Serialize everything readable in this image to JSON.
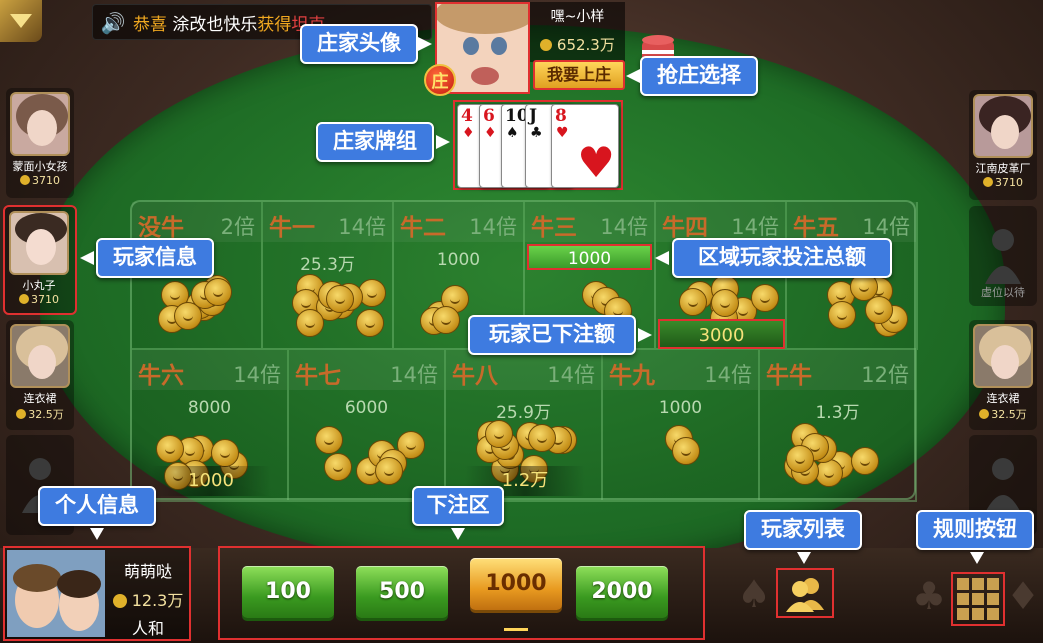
{
  "announcement": {
    "prefix": "恭喜",
    "text": "涂改也快乐",
    "suffix1": "获",
    "suffix2": "得",
    "suffix3": "坦克"
  },
  "banker": {
    "name": "嘿~小样",
    "coins": "652.3万",
    "badge": "庄",
    "grab_button": "我要上庄",
    "cards": [
      {
        "rank": "4",
        "suit": "♦",
        "color": "#d8151e"
      },
      {
        "rank": "6",
        "suit": "♦",
        "color": "#d8151e"
      },
      {
        "rank": "10",
        "suit": "♠",
        "color": "#111111"
      },
      {
        "rank": "J",
        "suit": "♣",
        "color": "#111111"
      },
      {
        "rank": "8",
        "suit": "♥",
        "color": "#d8151e"
      }
    ]
  },
  "left_players": [
    {
      "name": "蒙面小女孩",
      "coins": "3710"
    },
    {
      "name": "小丸子",
      "coins": "3710"
    },
    {
      "name": "连衣裙",
      "coins": "32.5万"
    },
    {
      "name": "",
      "coins": ""
    }
  ],
  "right_players": [
    {
      "name": "江南皮革厂",
      "coins": "3710"
    },
    {
      "name": "虚位以待",
      "coins": ""
    },
    {
      "name": "连衣裙",
      "coins": "32.5万"
    },
    {
      "name": "",
      "coins": ""
    }
  ],
  "zones_row1": [
    {
      "name": "没牛",
      "mult": "2倍",
      "total": ""
    },
    {
      "name": "牛一",
      "mult": "14倍",
      "total": "25.3万"
    },
    {
      "name": "牛二",
      "mult": "14倍",
      "total": "1000"
    },
    {
      "name": "牛三",
      "mult": "14倍",
      "total": "1000"
    },
    {
      "name": "牛四",
      "mult": "14倍",
      "total": ""
    },
    {
      "name": "牛五",
      "mult": "14倍",
      "total": ""
    }
  ],
  "zones_row2": [
    {
      "name": "牛六",
      "mult": "14倍",
      "total": "8000",
      "my_bet": "1000"
    },
    {
      "name": "牛七",
      "mult": "14倍",
      "total": "6000",
      "my_bet": ""
    },
    {
      "name": "牛八",
      "mult": "14倍",
      "total": "25.9万",
      "my_bet": "1.2万"
    },
    {
      "name": "牛九",
      "mult": "14倍",
      "total": "1000",
      "my_bet": ""
    },
    {
      "name": "牛牛",
      "mult": "12倍",
      "total": "1.3万",
      "my_bet": ""
    }
  ],
  "my_bet_niu_si": "3000",
  "self": {
    "name": "萌萌哒",
    "coins": "12.3万",
    "extra": "人和"
  },
  "chips": [
    "100",
    "500",
    "1000",
    "2000"
  ],
  "selected_chip": "1000",
  "callouts": {
    "banker_avatar": "庄家头像",
    "grab_banker": "抢庄选择",
    "banker_cards": "庄家牌组",
    "player_info": "玩家信息",
    "zone_total": "区域玩家投注总额",
    "my_bet": "玩家已下注额",
    "self_info": "个人信息",
    "bet_area": "下注区",
    "player_list": "玩家列表",
    "rules": "规则按钮"
  }
}
